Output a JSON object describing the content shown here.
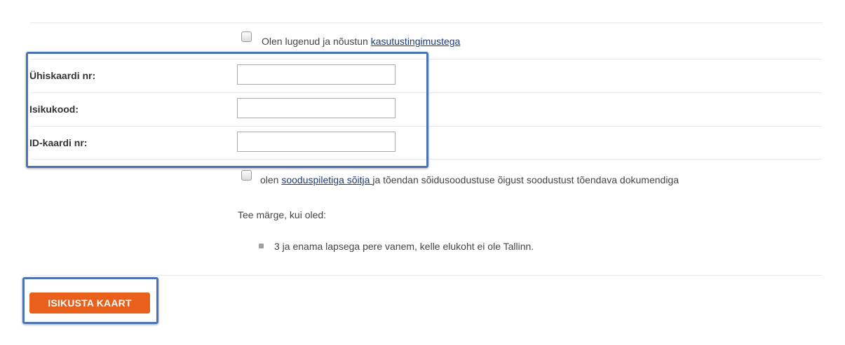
{
  "terms": {
    "text_before": "Olen lugenud ja nõustun ",
    "link": "kasutustingimustega"
  },
  "fields": [
    {
      "label": "Ühiskaardi nr:",
      "value": ""
    },
    {
      "label": "Isikukood:",
      "value": ""
    },
    {
      "label": "ID-kaardi nr:",
      "value": ""
    }
  ],
  "discount": {
    "text_before": "olen ",
    "link": "sooduspiletiga sõitja ",
    "text_after": "ja tõendan sõidusoodustuse õigust soodustust tõendava dokumendiga"
  },
  "mark_prompt": "Tee märge, kui oled:",
  "options": [
    "3 ja enama lapsega pere vanem, kelle elukoht ei ole Tallinn."
  ],
  "submit_label": "ISIKUSTA KAART",
  "colors": {
    "highlight_border": "#4a74b4",
    "button_bg": "#e8601c",
    "link": "#1a3b78"
  }
}
